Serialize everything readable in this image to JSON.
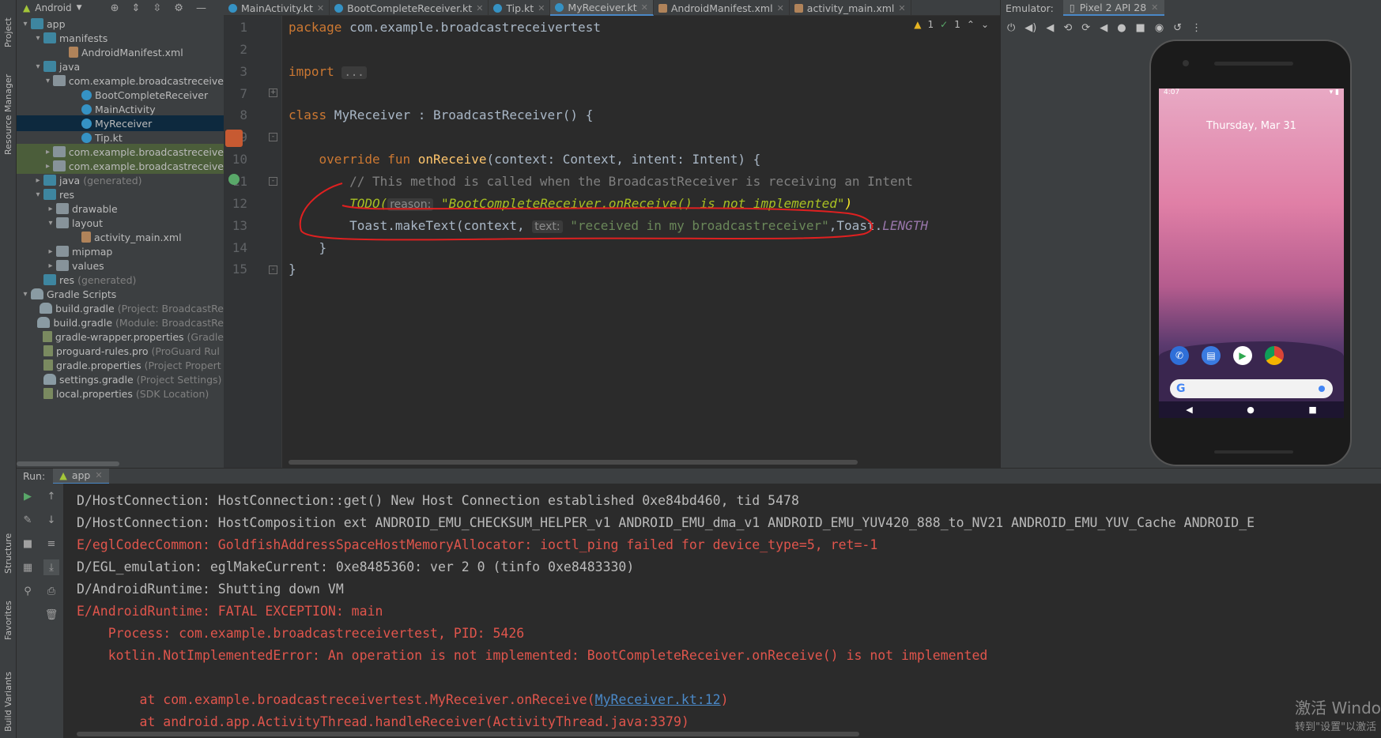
{
  "left_strip": {
    "project": "Project",
    "resource_manager": "Resource Manager",
    "structure": "Structure",
    "favorites": "Favorites",
    "build_variants": "Build Variants"
  },
  "project_panel": {
    "view_mode": "Android",
    "tree": [
      {
        "label": "app",
        "note": "",
        "indent": 0,
        "arrow": "down",
        "icon": "folder-blue"
      },
      {
        "label": "manifests",
        "note": "",
        "indent": 1,
        "arrow": "down",
        "icon": "folder-blue"
      },
      {
        "label": "AndroidManifest.xml",
        "note": "",
        "indent": 3,
        "arrow": "",
        "icon": "xml"
      },
      {
        "label": "java",
        "note": "",
        "indent": 1,
        "arrow": "down",
        "icon": "folder-blue"
      },
      {
        "label": "com.example.broadcastreceive",
        "note": "",
        "indent": 2,
        "arrow": "down",
        "icon": "folder"
      },
      {
        "label": "BootCompleteReceiver",
        "note": "",
        "indent": 4,
        "arrow": "",
        "icon": "kt"
      },
      {
        "label": "MainActivity",
        "note": "",
        "indent": 4,
        "arrow": "",
        "icon": "kt"
      },
      {
        "label": "MyReceiver",
        "note": "",
        "indent": 4,
        "arrow": "",
        "icon": "kt",
        "state": "selected"
      },
      {
        "label": "Tip.kt",
        "note": "",
        "indent": 4,
        "arrow": "",
        "icon": "kt"
      },
      {
        "label": "com.example.broadcastreceive",
        "note": "",
        "indent": 2,
        "arrow": "right",
        "icon": "folder",
        "state": "hl"
      },
      {
        "label": "com.example.broadcastreceive",
        "note": "",
        "indent": 2,
        "arrow": "right",
        "icon": "folder",
        "state": "hl"
      },
      {
        "label": "java",
        "note": "(generated)",
        "indent": 1,
        "arrow": "right",
        "icon": "folder-blue"
      },
      {
        "label": "res",
        "note": "",
        "indent": 1,
        "arrow": "down",
        "icon": "folder-blue"
      },
      {
        "label": "drawable",
        "note": "",
        "indent": 2,
        "arrow": "right",
        "icon": "folder"
      },
      {
        "label": "layout",
        "note": "",
        "indent": 2,
        "arrow": "down",
        "icon": "folder"
      },
      {
        "label": "activity_main.xml",
        "note": "",
        "indent": 4,
        "arrow": "",
        "icon": "xml"
      },
      {
        "label": "mipmap",
        "note": "",
        "indent": 2,
        "arrow": "right",
        "icon": "folder"
      },
      {
        "label": "values",
        "note": "",
        "indent": 2,
        "arrow": "right",
        "icon": "folder"
      },
      {
        "label": "res",
        "note": "(generated)",
        "indent": 1,
        "arrow": "",
        "icon": "folder-blue"
      },
      {
        "label": "Gradle Scripts",
        "note": "",
        "indent": 0,
        "arrow": "down",
        "icon": "gradle"
      },
      {
        "label": "build.gradle",
        "note": "(Project: BroadcastRe",
        "indent": 1,
        "arrow": "",
        "icon": "gradle"
      },
      {
        "label": "build.gradle",
        "note": "(Module: BroadcastRe",
        "indent": 1,
        "arrow": "",
        "icon": "gradle"
      },
      {
        "label": "gradle-wrapper.properties",
        "note": "(Gradle",
        "indent": 1,
        "arrow": "",
        "icon": "props"
      },
      {
        "label": "proguard-rules.pro",
        "note": "(ProGuard Rul",
        "indent": 1,
        "arrow": "",
        "icon": "props"
      },
      {
        "label": "gradle.properties",
        "note": "(Project Propert",
        "indent": 1,
        "arrow": "",
        "icon": "props"
      },
      {
        "label": "settings.gradle",
        "note": "(Project Settings)",
        "indent": 1,
        "arrow": "",
        "icon": "gradle"
      },
      {
        "label": "local.properties",
        "note": "(SDK Location)",
        "indent": 1,
        "arrow": "",
        "icon": "props"
      }
    ]
  },
  "tabs": [
    {
      "label": "MainActivity.kt",
      "icon": "kotlin-icon",
      "active": false
    },
    {
      "label": "BootCompleteReceiver.kt",
      "icon": "kotlin-icon",
      "active": false
    },
    {
      "label": "Tip.kt",
      "icon": "kotlin-icon",
      "active": false
    },
    {
      "label": "MyReceiver.kt",
      "icon": "kotlin-icon",
      "active": true
    },
    {
      "label": "AndroidManifest.xml",
      "icon": "xml-icon",
      "active": false
    },
    {
      "label": "activity_main.xml",
      "icon": "xml-icon",
      "active": false
    }
  ],
  "inspections": {
    "warnings": "1",
    "weak_warnings": "1"
  },
  "editor": {
    "line_numbers": [
      "1",
      "2",
      "3",
      "7",
      "8",
      "9",
      "10",
      "11",
      "12",
      "13",
      "14",
      "15"
    ],
    "package_kw": "package",
    "package_name": " com.example.broadcastreceivertest",
    "import_kw": "import",
    "import_fold": "...",
    "class_kw": "class",
    "class_rest": " MyReceiver : BroadcastReceiver() {",
    "override_kw": "override fun ",
    "on_receive": "onReceive",
    "on_receive_rest": "(context: Context, intent: Intent) {",
    "comment": "// This method is called when the BroadcastReceiver is receiving an Intent",
    "todo": "TODO(",
    "reason_hint": "reason:",
    "todo_str": "\"BootCompleteReceiver.onReceive() is not implemented\"",
    "todo_close": ")",
    "toast_start": "Toast.makeText(context,",
    "text_hint": "text:",
    "toast_str": "\"received in my broadcastreceiver\"",
    "toast_mid": ",Toast.",
    "toast_const": "LENGTH",
    "close_inner": "}",
    "close_outer": "}"
  },
  "emulator": {
    "label": "Emulator:",
    "device": "Pixel 2 API 28",
    "status_time": "4:07",
    "date": "Thursday, Mar 31",
    "search_logo": "G",
    "nav": [
      "◀",
      "●",
      "■"
    ]
  },
  "run": {
    "label": "Run:",
    "config": "app",
    "lines": [
      {
        "text": "D/HostConnection: HostConnection::get() New Host Connection established 0xe84bd460, tid 5478",
        "err": false
      },
      {
        "text": "D/HostConnection: HostComposition ext ANDROID_EMU_CHECKSUM_HELPER_v1 ANDROID_EMU_dma_v1 ANDROID_EMU_YUV420_888_to_NV21 ANDROID_EMU_YUV_Cache ANDROID_E",
        "err": false
      },
      {
        "text": "E/eglCodecCommon: GoldfishAddressSpaceHostMemoryAllocator: ioctl_ping failed for device_type=5, ret=-1",
        "err": true
      },
      {
        "text": "D/EGL_emulation: eglMakeCurrent: 0xe8485360: ver 2 0 (tinfo 0xe8483330)",
        "err": false
      },
      {
        "text": "D/AndroidRuntime: Shutting down VM",
        "err": false
      },
      {
        "text": "E/AndroidRuntime: FATAL EXCEPTION: main",
        "err": true
      },
      {
        "text": "    Process: com.example.broadcastreceivertest, PID: 5426",
        "err": true
      },
      {
        "text": "    kotlin.NotImplementedError: An operation is not implemented: BootCompleteReceiver.onReceive() is not implemented",
        "err": true
      }
    ],
    "stack1_prefix": "        at com.example.broadcastreceivertest.MyReceiver.onReceive(",
    "stack1_link": "MyReceiver.kt:12",
    "stack1_suffix": ")",
    "stack2": "        at android.app.ActivityThread.handleReceiver(ActivityThread.java:3379)"
  },
  "watermark": {
    "line1": "激活 Windo",
    "line2": "转到\"设置\"以激活"
  },
  "colors": {
    "error": "#e0554c",
    "keyword": "#cc7832",
    "function": "#ffc66d",
    "todo": "#a8c023",
    "link": "#4a88c7",
    "annotation_circle": "#e02020"
  }
}
